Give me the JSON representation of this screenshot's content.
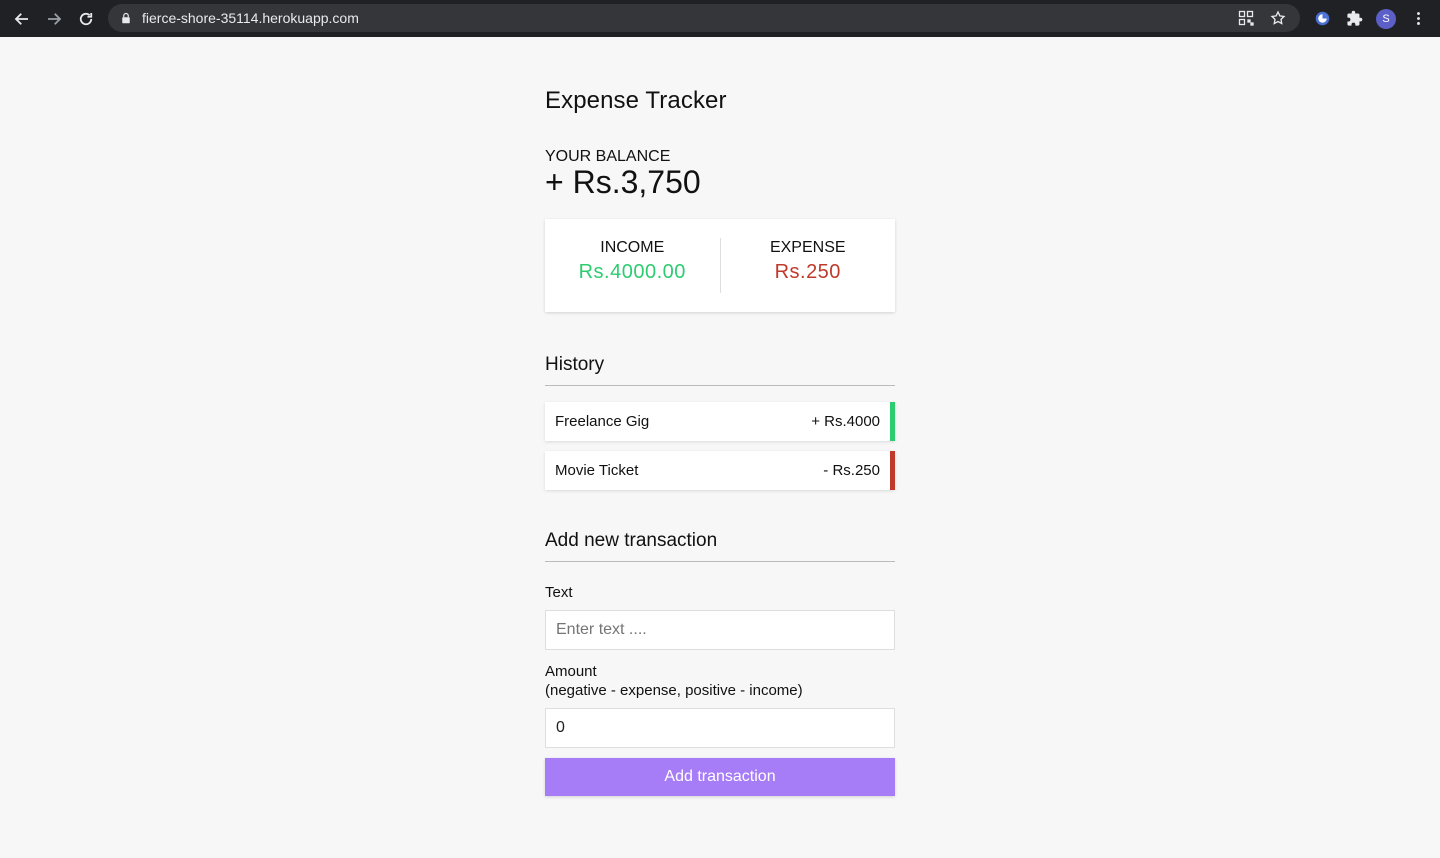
{
  "browser": {
    "url": "fierce-shore-35114.herokuapp.com",
    "avatar_letter": "S"
  },
  "app": {
    "title": "Expense Tracker",
    "balance_label": "YOUR BALANCE",
    "balance_amount": "+ Rs.3,750",
    "income_label": "INCOME",
    "income_amount": "Rs.4000.00",
    "expense_label": "EXPENSE",
    "expense_amount": "Rs.250",
    "history_title": "History",
    "transactions": [
      {
        "text": "Freelance Gig",
        "amount": "+ Rs.4000",
        "type": "plus"
      },
      {
        "text": "Movie Ticket",
        "amount": "- Rs.250",
        "type": "minus"
      }
    ],
    "add_title": "Add new transaction",
    "text_label": "Text",
    "text_placeholder": "Enter text ....",
    "amount_label": "Amount",
    "amount_hint": "(negative - expense, positive - income)",
    "amount_value": "0",
    "submit_label": "Add transaction"
  },
  "colors": {
    "income": "#2ecc71",
    "expense": "#c0392b",
    "button": "#a77cf7"
  }
}
